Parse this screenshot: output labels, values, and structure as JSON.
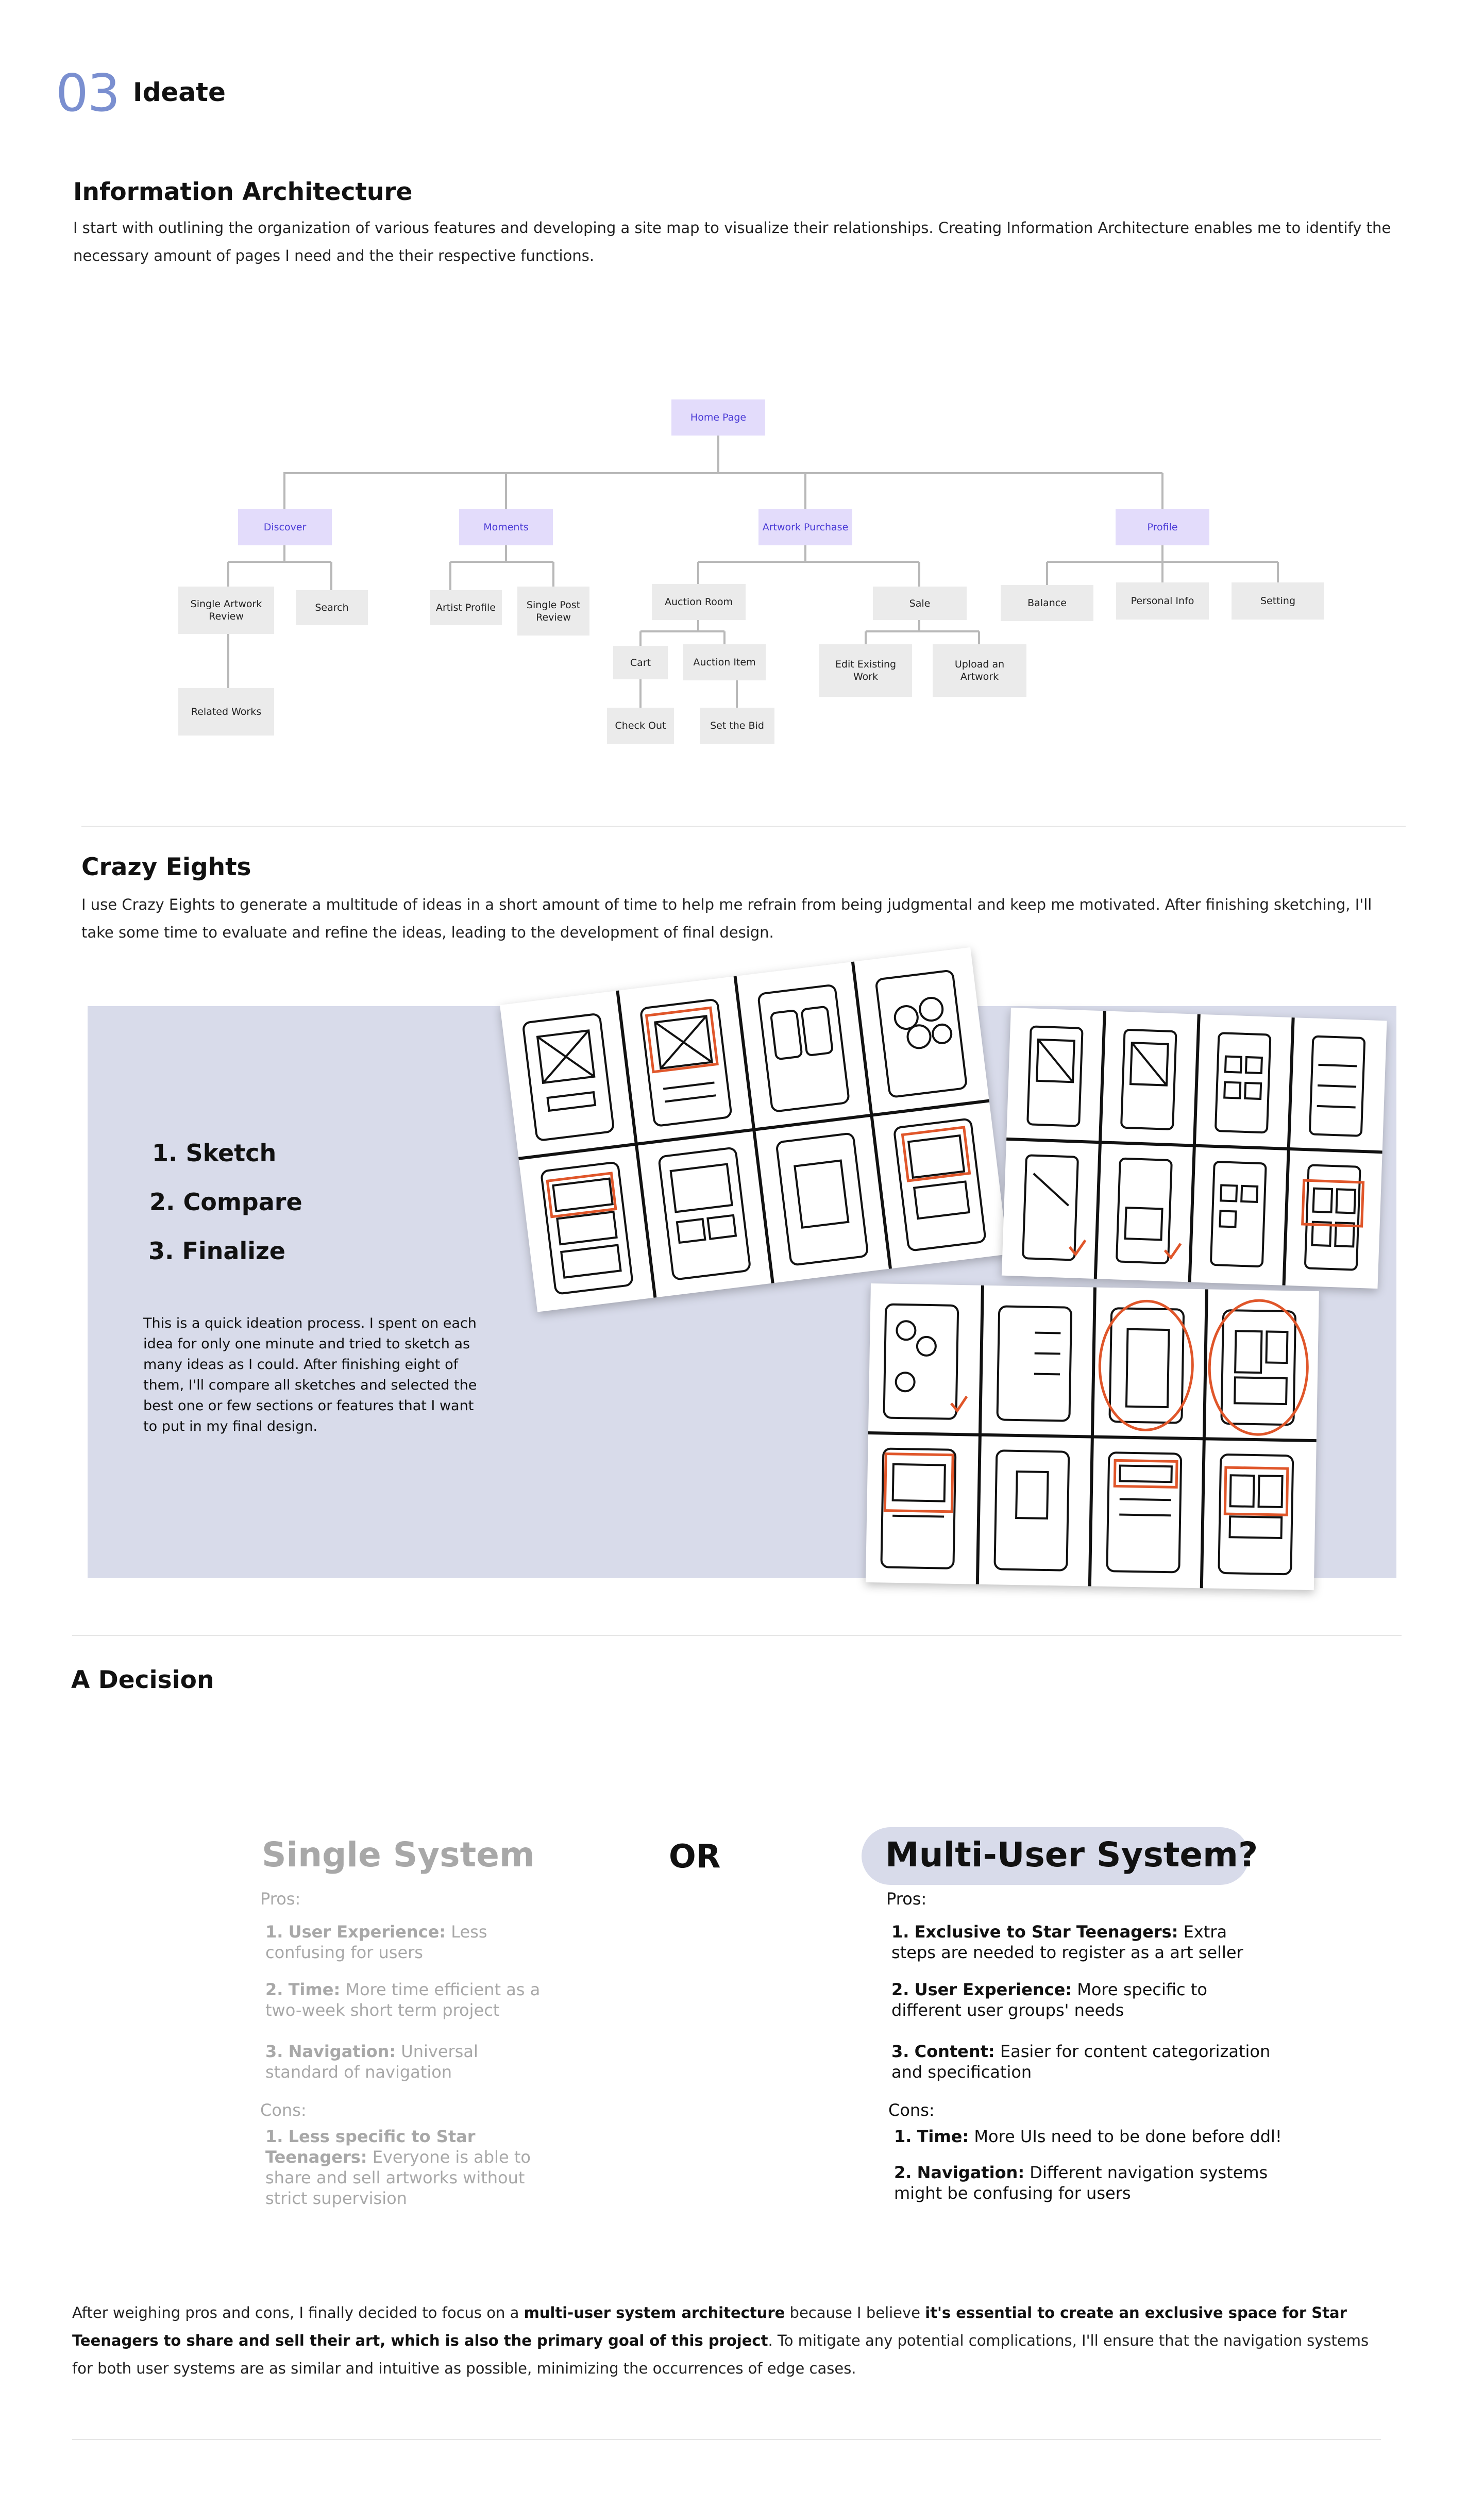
{
  "section": {
    "number": "03",
    "title": "Ideate"
  },
  "ia": {
    "heading": "Information Architecture",
    "body": "I start with outlining the organization of various features and developing a site map to visualize their relationships. Creating Information Architecture enables me to identify the necessary amount of pages I need and the their respective functions.",
    "nodes": {
      "home": "Home Page",
      "discover": "Discover",
      "moments": "Moments",
      "artwork_purchase": "Artwork Purchase",
      "profile": "Profile",
      "single_artwork_review": "Single Artwork Review",
      "search": "Search",
      "related_works": "Related Works",
      "artist_profile": "Artist Profile",
      "single_post_review": "Single Post Review",
      "auction_room": "Auction Room",
      "sale": "Sale",
      "cart": "Cart",
      "auction_item": "Auction Item",
      "check_out": "Check Out",
      "set_the_bid": "Set the Bid",
      "edit_existing_work": "Edit Existing Work",
      "upload_an_artwork": "Upload an Artwork",
      "balance": "Balance",
      "personal_info": "Personal Info",
      "setting": "Setting"
    }
  },
  "crazy_eights": {
    "heading": "Crazy Eights",
    "body": "I use Crazy Eights to generate a multitude of ideas in a short amount of time to help me refrain from being judgmental and keep me motivated. After finishing sketching, I'll take some time to evaluate and refine the ideas, leading to the development of final design.",
    "steps": [
      "1. Sketch",
      "2. Compare",
      "3. Finalize"
    ],
    "description": "This is a quick ideation process. I spent on each idea for only one minute and tried to sketch as many ideas as I could. After finishing eight of them, I'll compare all sketches and selected the best one or few sections or features that I want to put in my final design.",
    "accent_color": "#e0562a"
  },
  "decision": {
    "heading": "A Decision",
    "single": {
      "title": "Single System",
      "pros_label": "Pros:",
      "pros": [
        {
          "n": "1.",
          "key": "User Experience:",
          "text": " Less confusing for users"
        },
        {
          "n": "2.",
          "key": "Time:",
          "text": " More time efficient as a two-week short term project"
        },
        {
          "n": "3.",
          "key": "Navigation:",
          "text": " Universal standard of navigation"
        }
      ],
      "cons_label": "Cons:",
      "cons": [
        {
          "n": "1.",
          "key": "Less specific to Star Teenagers:",
          "text": " Everyone is able to share and sell artworks without strict supervision"
        }
      ]
    },
    "or": "OR",
    "multi": {
      "title": "Multi-User System?",
      "pros_label": "Pros:",
      "pros": [
        {
          "n": "1.",
          "key": "Exclusive to Star Teenagers:",
          "text": " Extra steps are needed to register as a art seller"
        },
        {
          "n": "2.",
          "key": "User Experience:",
          "text": " More specific to different user groups' needs"
        },
        {
          "n": "3.",
          "key": "Content:",
          "text": " Easier for content categorization and specification"
        }
      ],
      "cons_label": "Cons:",
      "cons": [
        {
          "n": "1.",
          "key": "Time:",
          "text": " More UIs need to be done before ddl!"
        },
        {
          "n": "2.",
          "key": "Navigation:",
          "text": " Different navigation systems might be confusing for users"
        }
      ]
    },
    "conclusion": {
      "t1": "After weighing pros and cons, I finally decided to focus on a ",
      "b1": "multi-user system architecture",
      "t2": " because I believe ",
      "b2": "it's essential to create an exclusive space for Star Teenagers to share and sell their art, which is also the primary goal of this project",
      "t3": ". To mitigate any potential complications, I'll ensure that the navigation systems for both user systems are as similar and intuitive as possible, minimizing the occurrences of edge cases."
    }
  }
}
